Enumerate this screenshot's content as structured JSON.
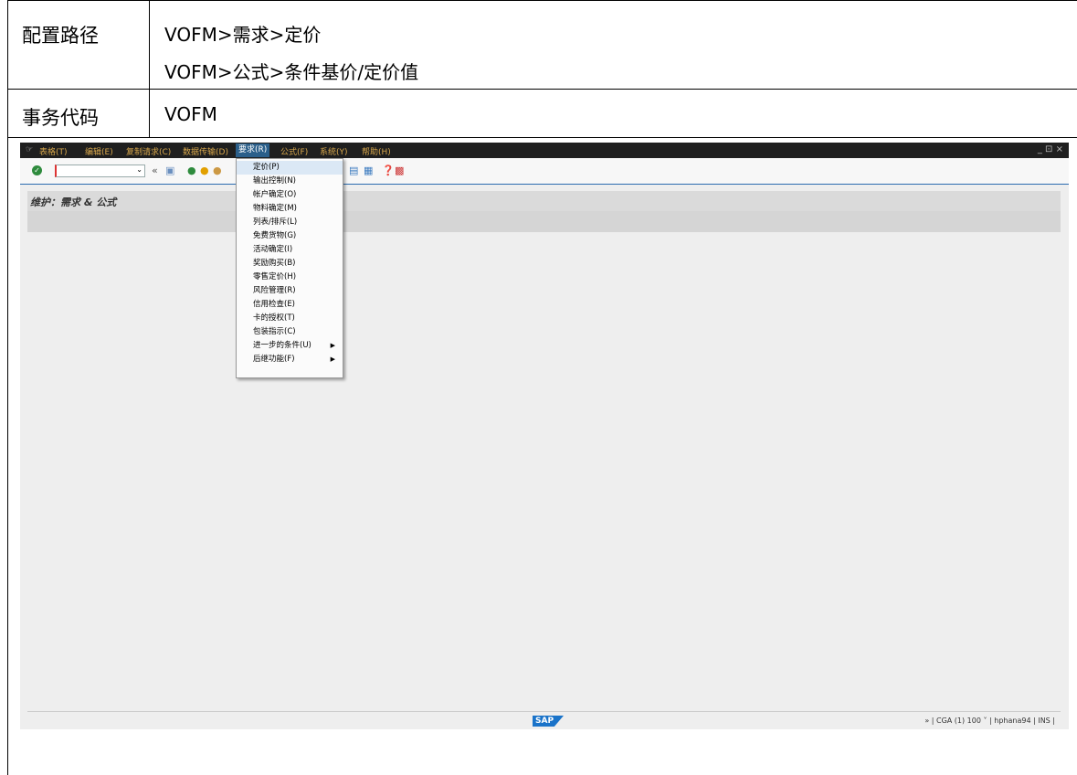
{
  "doc": {
    "path_label": "配置路径",
    "path_line1": "VOFM>需求>定价",
    "path_line2": "VOFM>公式>条件基价/定价值",
    "tcode_label": "事务代码",
    "tcode_value": "VOFM"
  },
  "menubar": {
    "items": [
      "表格(T)",
      "编辑(E)",
      "复制请求(C)",
      "数据传输(D)",
      "要求(R)",
      "公式(F)",
      "系统(Y)",
      "帮助(H)"
    ],
    "active_index": 4,
    "window_controls": "_ ⊡ ×"
  },
  "toolbar": {
    "command_field_value": "",
    "icons": [
      "enter-icon",
      "back-icon",
      "save-icon",
      "back-green-icon",
      "exit-icon",
      "cancel-icon",
      "layout-icon",
      "help-icon",
      "customize-icon"
    ]
  },
  "title": "维护：需求 & 公式",
  "dropdown": {
    "items": [
      {
        "label": "定价(P)",
        "submenu": false
      },
      {
        "label": "输出控制(N)",
        "submenu": false
      },
      {
        "label": "帐户确定(O)",
        "submenu": false
      },
      {
        "label": "物料确定(M)",
        "submenu": false
      },
      {
        "label": "列表/排斥(L)",
        "submenu": false
      },
      {
        "label": "免费货物(G)",
        "submenu": false
      },
      {
        "label": "活动确定(I)",
        "submenu": false
      },
      {
        "label": "奖励购买(B)",
        "submenu": false
      },
      {
        "label": "零售定价(H)",
        "submenu": false
      },
      {
        "label": "风险管理(R)",
        "submenu": false
      },
      {
        "label": "信用检查(E)",
        "submenu": false
      },
      {
        "label": "卡的授权(T)",
        "submenu": false
      },
      {
        "label": "包装指示(C)",
        "submenu": false
      },
      {
        "label": "进一步的条件(U)",
        "submenu": true
      },
      {
        "label": "后继功能(F)",
        "submenu": true
      }
    ],
    "highlight_index": 0
  },
  "status": {
    "logo": "SAP",
    "right_text": "» | CGA (1) 100 ˅ | hphana94 | INS |"
  },
  "colors": {
    "menubar_bg": "#1f1f1f",
    "menu_text": "#d9a84c",
    "active_menu": "#2b5f8a",
    "accent_line": "#2b6cb0",
    "sap_blue": "#1a73c9"
  }
}
